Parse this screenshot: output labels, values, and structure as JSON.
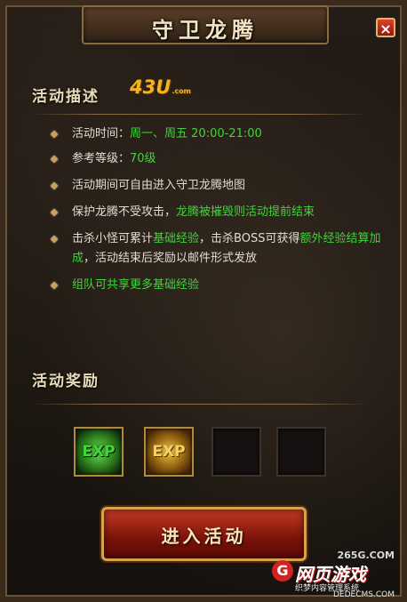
{
  "window": {
    "title": "守卫龙腾",
    "close_label": "×"
  },
  "description": {
    "heading": "活动描述",
    "logo_main": "43U",
    "logo_suffix": ".com",
    "items": [
      {
        "label": "活动时间：",
        "highlight": "周一、周五 20:00-21:00"
      },
      {
        "label": "参考等级：",
        "highlight": "70级"
      },
      {
        "label": "活动期间可自由进入守卫龙腾地图"
      },
      {
        "label": "保护龙腾不受攻击，",
        "highlight": "龙腾被摧毁则活动提前结束"
      },
      {
        "label": "击杀小怪可累计",
        "highlight": "基础经验",
        "label2": "，击杀BOSS可获得",
        "highlight2": "额外经验结算加成",
        "label3": "，活动结束后奖励以邮件形式发放"
      },
      {
        "highlight": "组队可共享更多基础经验"
      }
    ]
  },
  "rewards": {
    "heading": "活动奖励",
    "slots": [
      {
        "icon": "exp-green-icon",
        "label": "EXP"
      },
      {
        "icon": "exp-orange-icon",
        "label": "EXP"
      },
      {
        "icon": "empty-slot"
      },
      {
        "icon": "empty-slot"
      }
    ]
  },
  "action": {
    "enter_label": "进入活动"
  },
  "watermark": {
    "url": "265G.COM",
    "logo_letter": "G",
    "name": "网页游戏",
    "sub": "织梦内容管理系统",
    "sub2": "DEDECMS.COM"
  },
  "colors": {
    "highlight_green": "#41d33b",
    "button_red": "#9a1e10",
    "gold_border": "#d6a24c"
  }
}
